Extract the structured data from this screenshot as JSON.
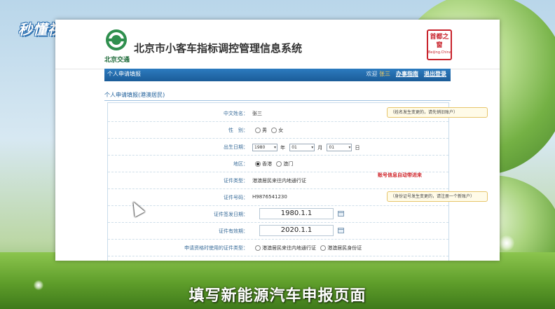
{
  "watermark": "秒懂视频",
  "header": {
    "org_name": "北京交通",
    "system_title": "北京市小客车指标调控管理信息系统",
    "seal_text": "首都之窗",
    "seal_sub": "Beijing.China"
  },
  "nav": {
    "tab": "个人申请填报",
    "greeting": "欢迎",
    "user": "张三",
    "guide": "办事指南",
    "logout": "退出登录"
  },
  "section_title": "个人申请填报(港澳居民)",
  "form": {
    "chinese_name": {
      "label": "中文姓名：",
      "value": "张三",
      "hint": "（姓名发生变更的，请先销旧账户）"
    },
    "gender": {
      "label": "性　别：",
      "options": [
        "男",
        "女"
      ]
    },
    "birth": {
      "label": "出生日期：",
      "year": "1980",
      "month": "01",
      "day": "01",
      "year_unit": "年",
      "month_unit": "月",
      "day_unit": "日"
    },
    "auto_note": "账号信息自动带进来",
    "region": {
      "label": "地区：",
      "options": [
        "香港",
        "澳门"
      ],
      "selected": "香港"
    },
    "cert_type": {
      "label": "证件类型：",
      "value": "港澳居民来往内地通行证"
    },
    "cert_no": {
      "label": "证件号码：",
      "value": "H9876541230",
      "hint": "（身份证号发生变更的，请注册一个新账户）"
    },
    "issue_date": {
      "label": "证件签发日期：",
      "value": "1980.1.1"
    },
    "expiry_date": {
      "label": "证件有效期：",
      "value": "2020.1.1"
    },
    "apply_cert": {
      "label": "申请资格时使用的证件类型：",
      "options": [
        "港澳居民来往内地通行证",
        "港澳居民身份证"
      ]
    }
  },
  "caption": "填写新能源汽车申报页面"
}
